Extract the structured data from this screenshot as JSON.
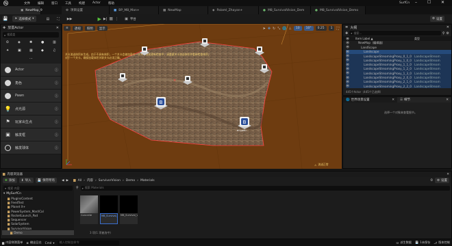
{
  "title_bar": {
    "menus": [
      "文件",
      "编辑",
      "窗口",
      "工具",
      "构建",
      "Actor",
      "帮助"
    ],
    "project": "SurfCn"
  },
  "level_tab": "NewMap_9",
  "doc_tabs": [
    "项目设置",
    "BP_M8_Man+",
    "NewMap",
    "Palaml_Zhayan+",
    "M8_SurvivalVision_Dem",
    "M8_SurvivalVision_Demo"
  ],
  "toolbar": {
    "mode": "选择模式",
    "platform": "平台",
    "settings": "设置"
  },
  "place_actors": {
    "title": "放置Actor",
    "search_placeholder": "搜索类",
    "items": [
      "Actor",
      "角色",
      "Pawn",
      "点光源",
      "玩家出生点",
      "触发框",
      "触发球体"
    ]
  },
  "viewport": {
    "perspective": "透视",
    "lit": "照明",
    "show": "显示",
    "grid_size": "10",
    "rot": "10°",
    "scale": "0.25",
    "cam": "1",
    "warning": "关卡流送体积未生成。由于不具有体积，一个关卡会被加载在一次关卡流送更新检查中，请重建关卡流送体积并重新检查体积。",
    "warning2": "对于一个关卡，确保加载体积关联关卡必须正确。",
    "corner_label": "流送正常",
    "badge_label": "BingleBin"
  },
  "outliner": {
    "title": "大纲",
    "search_placeholder": "搜索...",
    "col_label": "Item Label ▲",
    "col_type": "类型",
    "rows": [
      {
        "label": "NewMap（编辑器）",
        "type": "",
        "indent": 1
      },
      {
        "label": "LandScape",
        "type": "",
        "indent": 2
      },
      {
        "label": "Landscape",
        "type": "",
        "indent": 3
      },
      {
        "label": "LandscapeStreamingProxy_0_1_0",
        "type": "LandscapeStream",
        "indent": 3
      },
      {
        "label": "LandscapeStreamingProxy_1_0_0",
        "type": "LandscapeStream",
        "indent": 3
      },
      {
        "label": "LandscapeStreamingProxy_1_1_0",
        "type": "LandscapeStream",
        "indent": 3
      },
      {
        "label": "LandscapeStreamingProxy_1_2_0",
        "type": "LandscapeStream",
        "indent": 3
      },
      {
        "label": "LandscapeStreamingProxy_1_3_0",
        "type": "LandscapeStream",
        "indent": 3
      },
      {
        "label": "LandscapeStreamingProxy_2_0_0",
        "type": "LandscapeStream",
        "indent": 3
      },
      {
        "label": "LandscapeStreamingProxy_2_1_0",
        "type": "LandscapeStream",
        "indent": 3
      },
      {
        "label": "LandscapeStreamingProxy_2_2_0",
        "type": "LandscapeStream",
        "indent": 3
      }
    ],
    "status": "445个Actor（445个已选择）"
  },
  "details": {
    "title": "细节",
    "tab2": "世界场景设置",
    "empty": "选择一个对象来查看细节。"
  },
  "content_browser": {
    "title": "内容浏览器",
    "add": "添加",
    "import": "导入",
    "save_all": "保存所有",
    "settings": "设置",
    "path": [
      "All",
      "内容",
      "SurvivorVision",
      "Demo",
      "Materials"
    ],
    "search_placeholder": "搜索 Materials",
    "filter_placeholder": "搜索 内容",
    "project": "MySurfCn",
    "tree": [
      "PluginsContent",
      "FeedTest",
      "Planet X+",
      "PowerSystem_Marl/Cal",
      "RocketLaunch_Pad",
      "Sequencer",
      "SolarSystem",
      "SurvivorVision",
      "Demo"
    ],
    "assets": [
      "Concrete",
      "M8_Survival_Vision_Demo_Material",
      "M8_Survival_Vision_Demo_M"
    ],
    "status": "3 项(1 项被选中)"
  },
  "status_bar": {
    "drawer": "内容侧滑菜单",
    "log": "输出日志",
    "cmd": "Cmd",
    "cmd_placeholder": "输入控制台命令",
    "derived": "派生数据",
    "unsaved": "1未保存",
    "source": "版本控制"
  },
  "colors": {
    "accent": "#e0a050",
    "terrain_bg": "#6e3c10",
    "selection": "#ff4040",
    "play": "#56c23d",
    "folder": "#c7a060"
  }
}
